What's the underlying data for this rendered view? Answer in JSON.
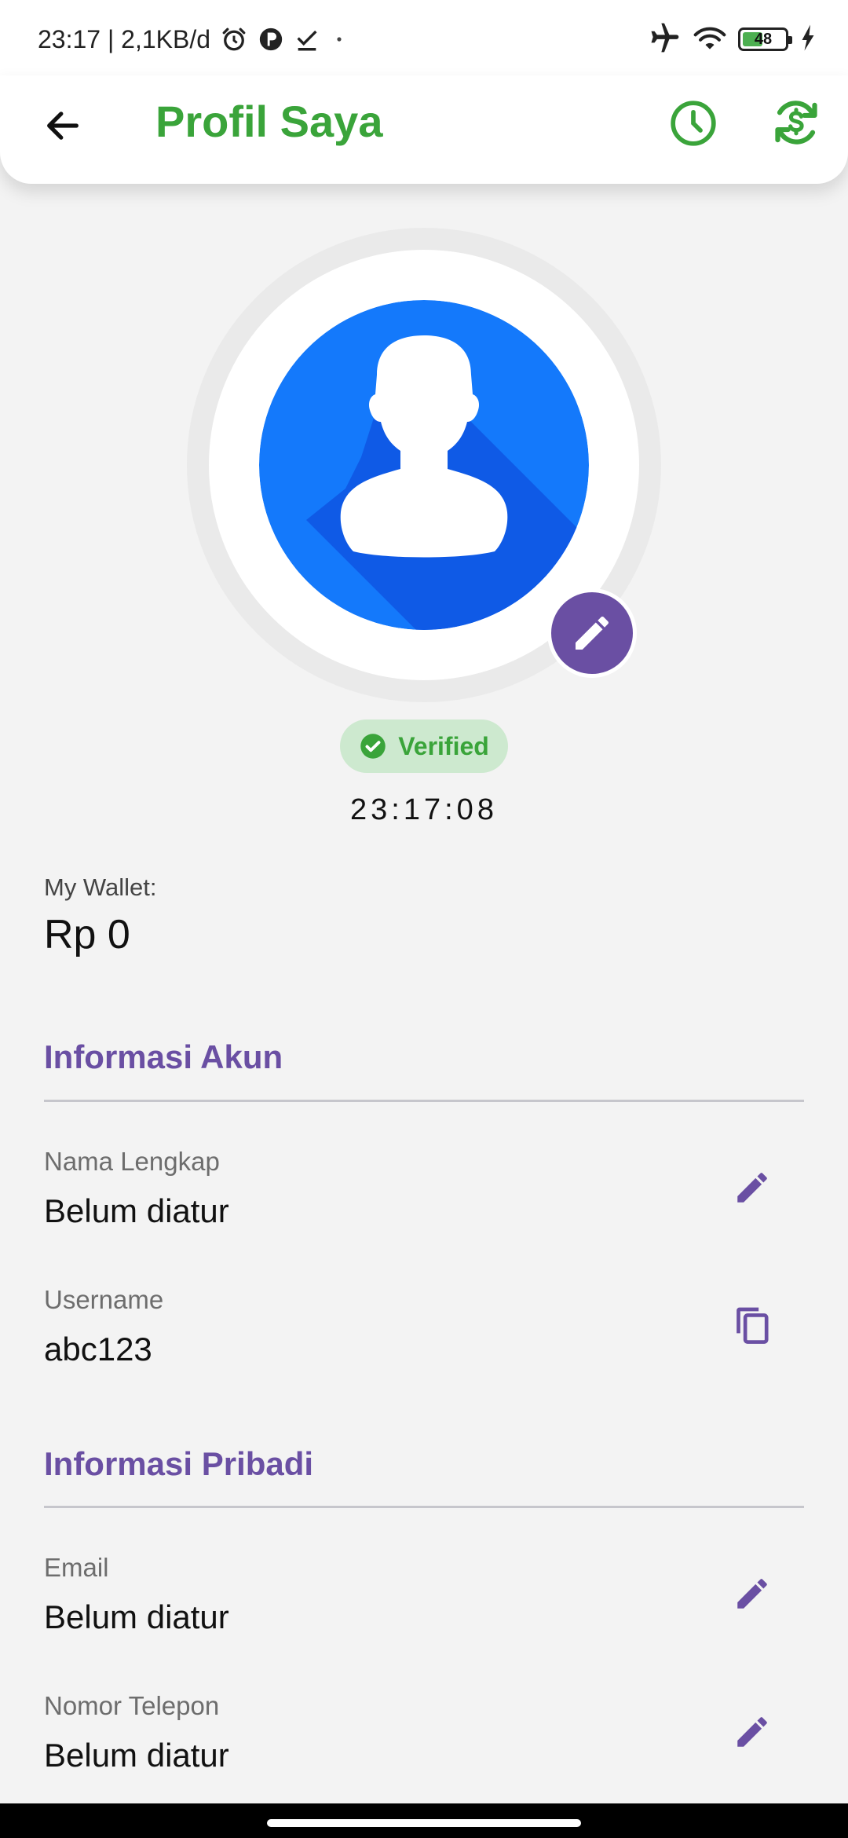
{
  "status_bar": {
    "time_and_speed": "23:17 | 2,1KB/d",
    "battery_level": "48",
    "battery_percent": 48
  },
  "header": {
    "title": "Profil Saya",
    "icons": {
      "back": "arrow-left-icon",
      "history": "clock-icon",
      "exchange": "currency-exchange-icon"
    }
  },
  "profile": {
    "verified_label": "Verified",
    "clock": "23:17:08",
    "avatar_icon": "user-avatar-icon",
    "edit_icon": "pencil-icon"
  },
  "wallet": {
    "label": "My Wallet:",
    "value": "Rp 0"
  },
  "sections": {
    "account": {
      "title": "Informasi Akun",
      "fields": [
        {
          "label": "Nama Lengkap",
          "value": "Belum diatur",
          "action_icon": "pencil-icon"
        },
        {
          "label": "Username",
          "value": "abc123",
          "action_icon": "copy-icon"
        }
      ]
    },
    "personal": {
      "title": "Informasi Pribadi",
      "fields": [
        {
          "label": "Email",
          "value": "Belum diatur",
          "action_icon": "pencil-icon"
        },
        {
          "label": "Nomor Telepon",
          "value": "Belum diatur",
          "action_icon": "pencil-icon"
        }
      ]
    }
  },
  "colors": {
    "brand_green": "#3aa43a",
    "accent_purple": "#6a4fa3",
    "avatar_blue": "#1479fb",
    "background": "#f3f3f3"
  }
}
